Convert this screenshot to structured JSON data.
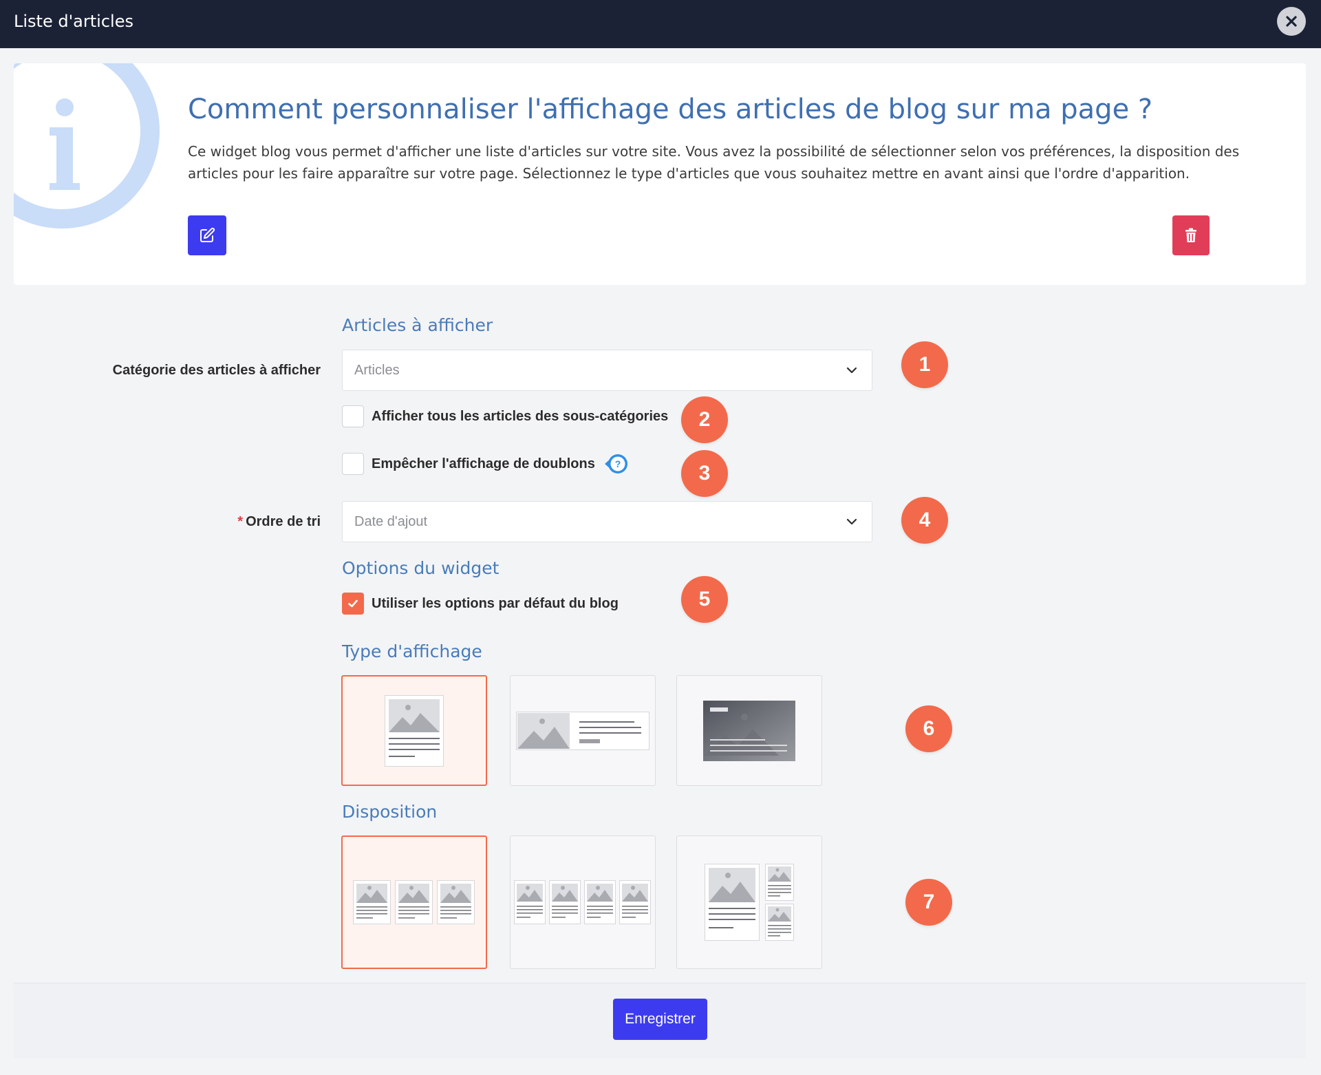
{
  "window": {
    "title": "Liste d'articles",
    "close_icon": "close-icon"
  },
  "info": {
    "title": "Comment personnaliser l'affichage des articles de blog sur ma page ?",
    "text": "Ce widget blog vous permet d'afficher une liste d'articles sur votre site. Vous avez la possibilité de sélectionner selon vos préférences, la disposition des articles pour les faire apparaître sur votre page. Sélectionnez le type d'articles que vous souhaitez mettre en avant ainsi que l'ordre d'apparition.",
    "edit_icon": "edit-icon",
    "delete_icon": "trash-icon"
  },
  "form": {
    "articles_section": "Articles à afficher",
    "category_label": "Catégorie des articles à afficher",
    "category_value": "Articles",
    "subcategories_label": "Afficher tous les articles des sous-catégories",
    "subcategories_checked": false,
    "duplicates_label": "Empêcher l'affichage de doublons",
    "duplicates_checked": false,
    "sort_required_mark": "*",
    "sort_label": "Ordre de tri",
    "sort_value": "Date d'ajout",
    "widget_options_section": "Options du widget",
    "default_options_label": "Utiliser les options par défaut du blog",
    "default_options_checked": true,
    "display_type_section": "Type d'affichage",
    "display_types": [
      "card-vertical",
      "card-horizontal",
      "card-overlay"
    ],
    "display_type_selected": 0,
    "layout_section": "Disposition",
    "layouts": [
      "three-columns",
      "four-columns",
      "featured-with-sidebar"
    ],
    "layout_selected": 0
  },
  "badges": [
    "1",
    "2",
    "3",
    "4",
    "5",
    "6",
    "7"
  ],
  "footer": {
    "save_label": "Enregistrer"
  },
  "colors": {
    "accent": "#f26a4b",
    "primary": "#3d3bf0",
    "danger": "#e23d58",
    "header": "#1c2236",
    "heading": "#3f6fb0"
  }
}
